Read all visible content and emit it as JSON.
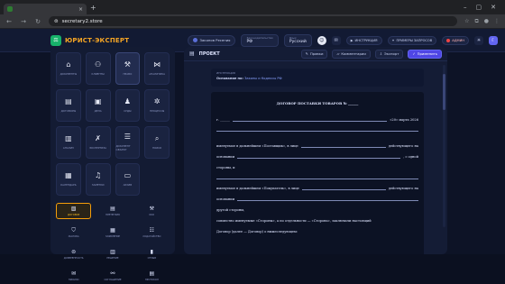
{
  "browser": {
    "tab_title": "",
    "url": "secretary2.store"
  },
  "header": {
    "logo_text": "ЮРИСТ-ЭКСПЕРТ",
    "user_pill": "Законов Ресения",
    "legislation": {
      "label": "Законодательство",
      "value": "РФ"
    },
    "language": {
      "label": "Язык",
      "value": "Русский"
    },
    "chip_instructions": "ИНСТРУКЦИЯ",
    "chip_examples": "ПРИМЕРЫ ЗАПРОСОВ",
    "chip_admin": "АДМИН"
  },
  "sidebar": {
    "cards": [
      {
        "label": "ДОКУМЕНТЫ",
        "icon": "home-icon",
        "glyph": "⌂"
      },
      {
        "label": "КЛИЕНТЫ",
        "icon": "users-icon",
        "glyph": "⚇"
      },
      {
        "label": "ПРАВО",
        "icon": "gavel-icon",
        "glyph": "⚒"
      },
      {
        "label": "АНАЛИТИКА",
        "icon": "network-icon",
        "glyph": "⋈"
      },
      {
        "label": "ДОГОВОРЫ",
        "icon": "document-icon",
        "glyph": "▤"
      },
      {
        "label": "ДЕЛА",
        "icon": "briefcase-icon",
        "glyph": "▣"
      },
      {
        "label": "СУДЫ",
        "icon": "person-icon",
        "glyph": "♟"
      },
      {
        "label": "ПРОЦЕССЫ",
        "icon": "gear-icon",
        "glyph": "✲"
      },
      {
        "label": "АНАЛИЗ",
        "icon": "chart-icon",
        "glyph": "▥"
      },
      {
        "label": "ЭКСПЕРТИЗА",
        "icon": "tools-icon",
        "glyph": "✗"
      },
      {
        "label": "ДОКУМЕНТ ОБЪЕКТ",
        "icon": "stack-icon",
        "glyph": "☰"
      },
      {
        "label": "ПОИСК",
        "icon": "search-icon",
        "glyph": "⌕"
      },
      {
        "label": "КАЛЕНДАРЬ",
        "icon": "calendar-icon",
        "glyph": "▦"
      },
      {
        "label": "ЗАМЕТКИ",
        "icon": "music-icon",
        "glyph": "♫"
      },
      {
        "label": "АРХИВ",
        "icon": "archive-icon",
        "glyph": "▭"
      }
    ],
    "tools": [
      {
        "label": "ДОГОВОР",
        "icon": "contract-icon",
        "glyph": "▧",
        "active": true
      },
      {
        "label": "ПРЕТЕНЗИЯ",
        "icon": "doc-stack-icon",
        "glyph": "▤"
      },
      {
        "label": "ИСК",
        "icon": "hammer-icon",
        "glyph": "⚒"
      },
      {
        "label": "ЖАЛОБА",
        "icon": "shield-icon",
        "glyph": "⛉"
      },
      {
        "label": "ЗАЯВЛЕНИЕ",
        "icon": "form-icon",
        "glyph": "▦"
      },
      {
        "label": "ХОДАТАЙСТВО",
        "icon": "list-icon",
        "glyph": "☷"
      },
      {
        "label": "ДОВЕРЕННОСТЬ",
        "icon": "seal-icon",
        "glyph": "⊜"
      },
      {
        "label": "РЕШЕНИЕ",
        "icon": "file-icon",
        "glyph": "▥"
      },
      {
        "label": "ОТЗЫВ",
        "icon": "bars-icon",
        "glyph": "▮"
      },
      {
        "label": "ПИСЬМО",
        "icon": "mail-icon",
        "glyph": "✉"
      },
      {
        "label": "СОГЛАШЕНИЕ",
        "icon": "handshake-icon",
        "glyph": "⚯"
      },
      {
        "label": "ПРОТОКОЛ",
        "icon": "protocol-icon",
        "glyph": "▤"
      }
    ]
  },
  "main": {
    "title": "ПРОЕКТ",
    "btn_edit": "Правки",
    "btn_comments": "Комментарии",
    "btn_export": "Экспорт",
    "btn_apply": "Применить",
    "meta_label": "ИНСТРУКЦИЯ",
    "meta_value_prefix": "Основание по:",
    "meta_value_link": "Законы и Кодексы РФ",
    "doc": {
      "title": "ДОГОВОР ПОСТАВКИ ТОВАРОВ № ______",
      "city": "г. ______",
      "date": "«20» марта 2026",
      "p1": "именуемое в дальнейшем «Поставщик», в лице",
      "p1b": "действующего на",
      "p2": "основании",
      "p2b": ", с одной",
      "p3": "стороны, и",
      "p4": "именуемое в дальнейшем «Покупатель», в лице",
      "p4b": "действующего на",
      "p5": "основании",
      "p6": "другой стороны,",
      "p7": "совместно именуемые «Стороны», а по отдельности — «Сторона», заключили настоящий",
      "p8": "Договор (далее — Договор) о нижеследующем:"
    }
  }
}
